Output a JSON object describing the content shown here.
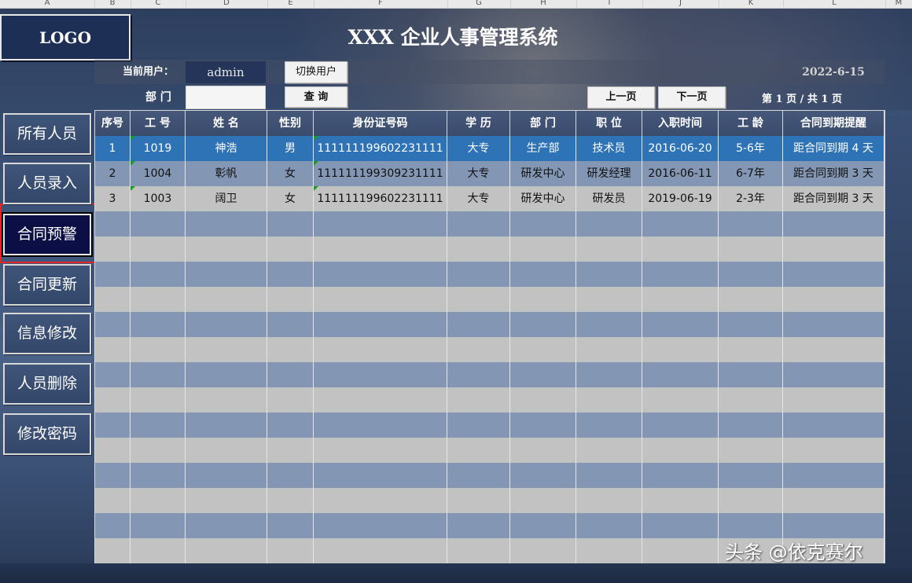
{
  "spreadsheet": {
    "columns": [
      "A",
      "B",
      "C",
      "D",
      "E",
      "F",
      "G",
      "H",
      "I",
      "J",
      "K",
      "L",
      "M"
    ]
  },
  "app": {
    "logo_text": "LOGO",
    "title": "XXX 企业人事管理系统"
  },
  "toolbar": {
    "current_user_label": "当前用户：",
    "current_user": "admin",
    "switch_user": "切换用户",
    "date": "2022-6-15",
    "department_label": "部 门",
    "department_value": "",
    "query": "查 询",
    "prev_page": "上一页",
    "next_page": "下一页",
    "page_info": "第 1 页 / 共 1 页"
  },
  "sidebar": {
    "items": [
      {
        "label": "所有人员"
      },
      {
        "label": "人员录入"
      },
      {
        "label": "合同预警",
        "active": true
      },
      {
        "label": "合同更新"
      },
      {
        "label": "信息修改"
      },
      {
        "label": "人员删除"
      },
      {
        "label": "修改密码"
      }
    ]
  },
  "table": {
    "headers": [
      "序号",
      "工 号",
      "姓 名",
      "性别",
      "身份证号码",
      "学 历",
      "部 门",
      "职 位",
      "入职时间",
      "工 龄",
      "合同到期提醒"
    ],
    "rows": [
      [
        "1",
        "1019",
        "神浩",
        "男",
        "111111199602231111",
        "大专",
        "生产部",
        "技术员",
        "2016-06-20",
        "5-6年",
        "距合同到期 4 天"
      ],
      [
        "2",
        "1004",
        "彰帆",
        "女",
        "111111199309231111",
        "大专",
        "研发中心",
        "研发经理",
        "2016-06-11",
        "6-7年",
        "距合同到期 3 天"
      ],
      [
        "3",
        "1003",
        "阔卫",
        "女",
        "111111199602231111",
        "大专",
        "研发中心",
        "研发员",
        "2019-06-19",
        "2-3年",
        "距合同到期 3 天"
      ]
    ],
    "selected_row": 0,
    "empty_rows": 14
  },
  "watermark": "头条 @依克赛尔",
  "colors": {
    "header_bg": "#3a4b6c",
    "selected_row": "#2e73b6",
    "row_blue": "#8397b4",
    "row_gray": "#c2c2c2",
    "active_nav": "#0b0f45",
    "highlight_outline": "#e02626"
  }
}
